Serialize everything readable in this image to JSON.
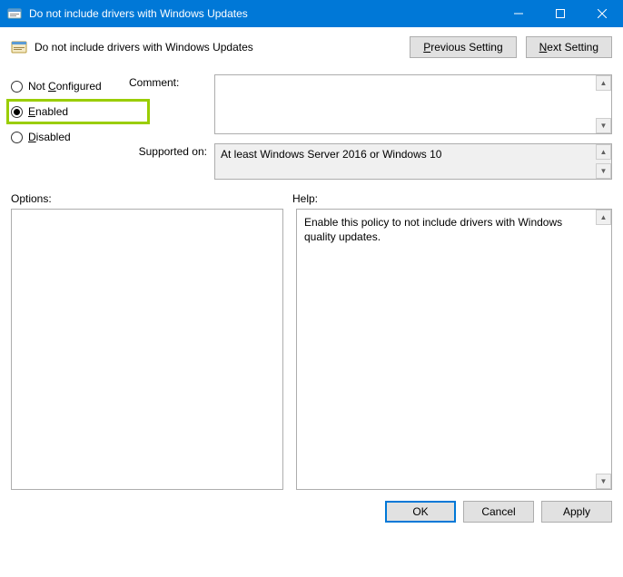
{
  "window": {
    "title": "Do not include drivers with Windows Updates"
  },
  "policy": {
    "title": "Do not include drivers with Windows Updates"
  },
  "nav": {
    "previous": "Previous Setting",
    "next": "Next Setting"
  },
  "radios": {
    "not_configured": "Not Configured",
    "enabled": "Enabled",
    "disabled": "Disabled",
    "selected": "enabled"
  },
  "labels": {
    "comment": "Comment:",
    "supported_on": "Supported on:",
    "options": "Options:",
    "help": "Help:"
  },
  "supported_on_text": "At least Windows Server 2016 or Windows 10",
  "help_text": "Enable this policy to not include drivers with Windows quality updates.",
  "footer": {
    "ok": "OK",
    "cancel": "Cancel",
    "apply": "Apply"
  }
}
